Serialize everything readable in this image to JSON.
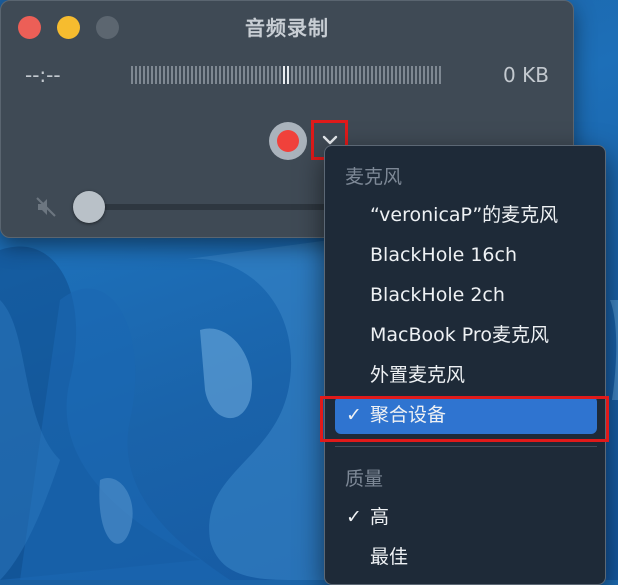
{
  "window": {
    "title": "音频录制",
    "time_display": "--:--",
    "file_size": "0 KB"
  },
  "menu": {
    "microphone_header": "麦克风",
    "microphones": [
      {
        "label": "“veronicaP”的麦克风",
        "checked": false
      },
      {
        "label": "BlackHole 16ch",
        "checked": false
      },
      {
        "label": "BlackHole 2ch",
        "checked": false
      },
      {
        "label": "MacBook Pro麦克风",
        "checked": false
      },
      {
        "label": "外置麦克风",
        "checked": false
      },
      {
        "label": "聚合设备",
        "checked": true
      }
    ],
    "quality_header": "质量",
    "qualities": [
      {
        "label": "高",
        "checked": true
      },
      {
        "label": "最佳",
        "checked": false
      }
    ],
    "check_glyph": "✓"
  },
  "colors": {
    "record": "#f0413b",
    "menu_selection": "#2f74d0",
    "annotation_outline": "#e01a1a"
  }
}
